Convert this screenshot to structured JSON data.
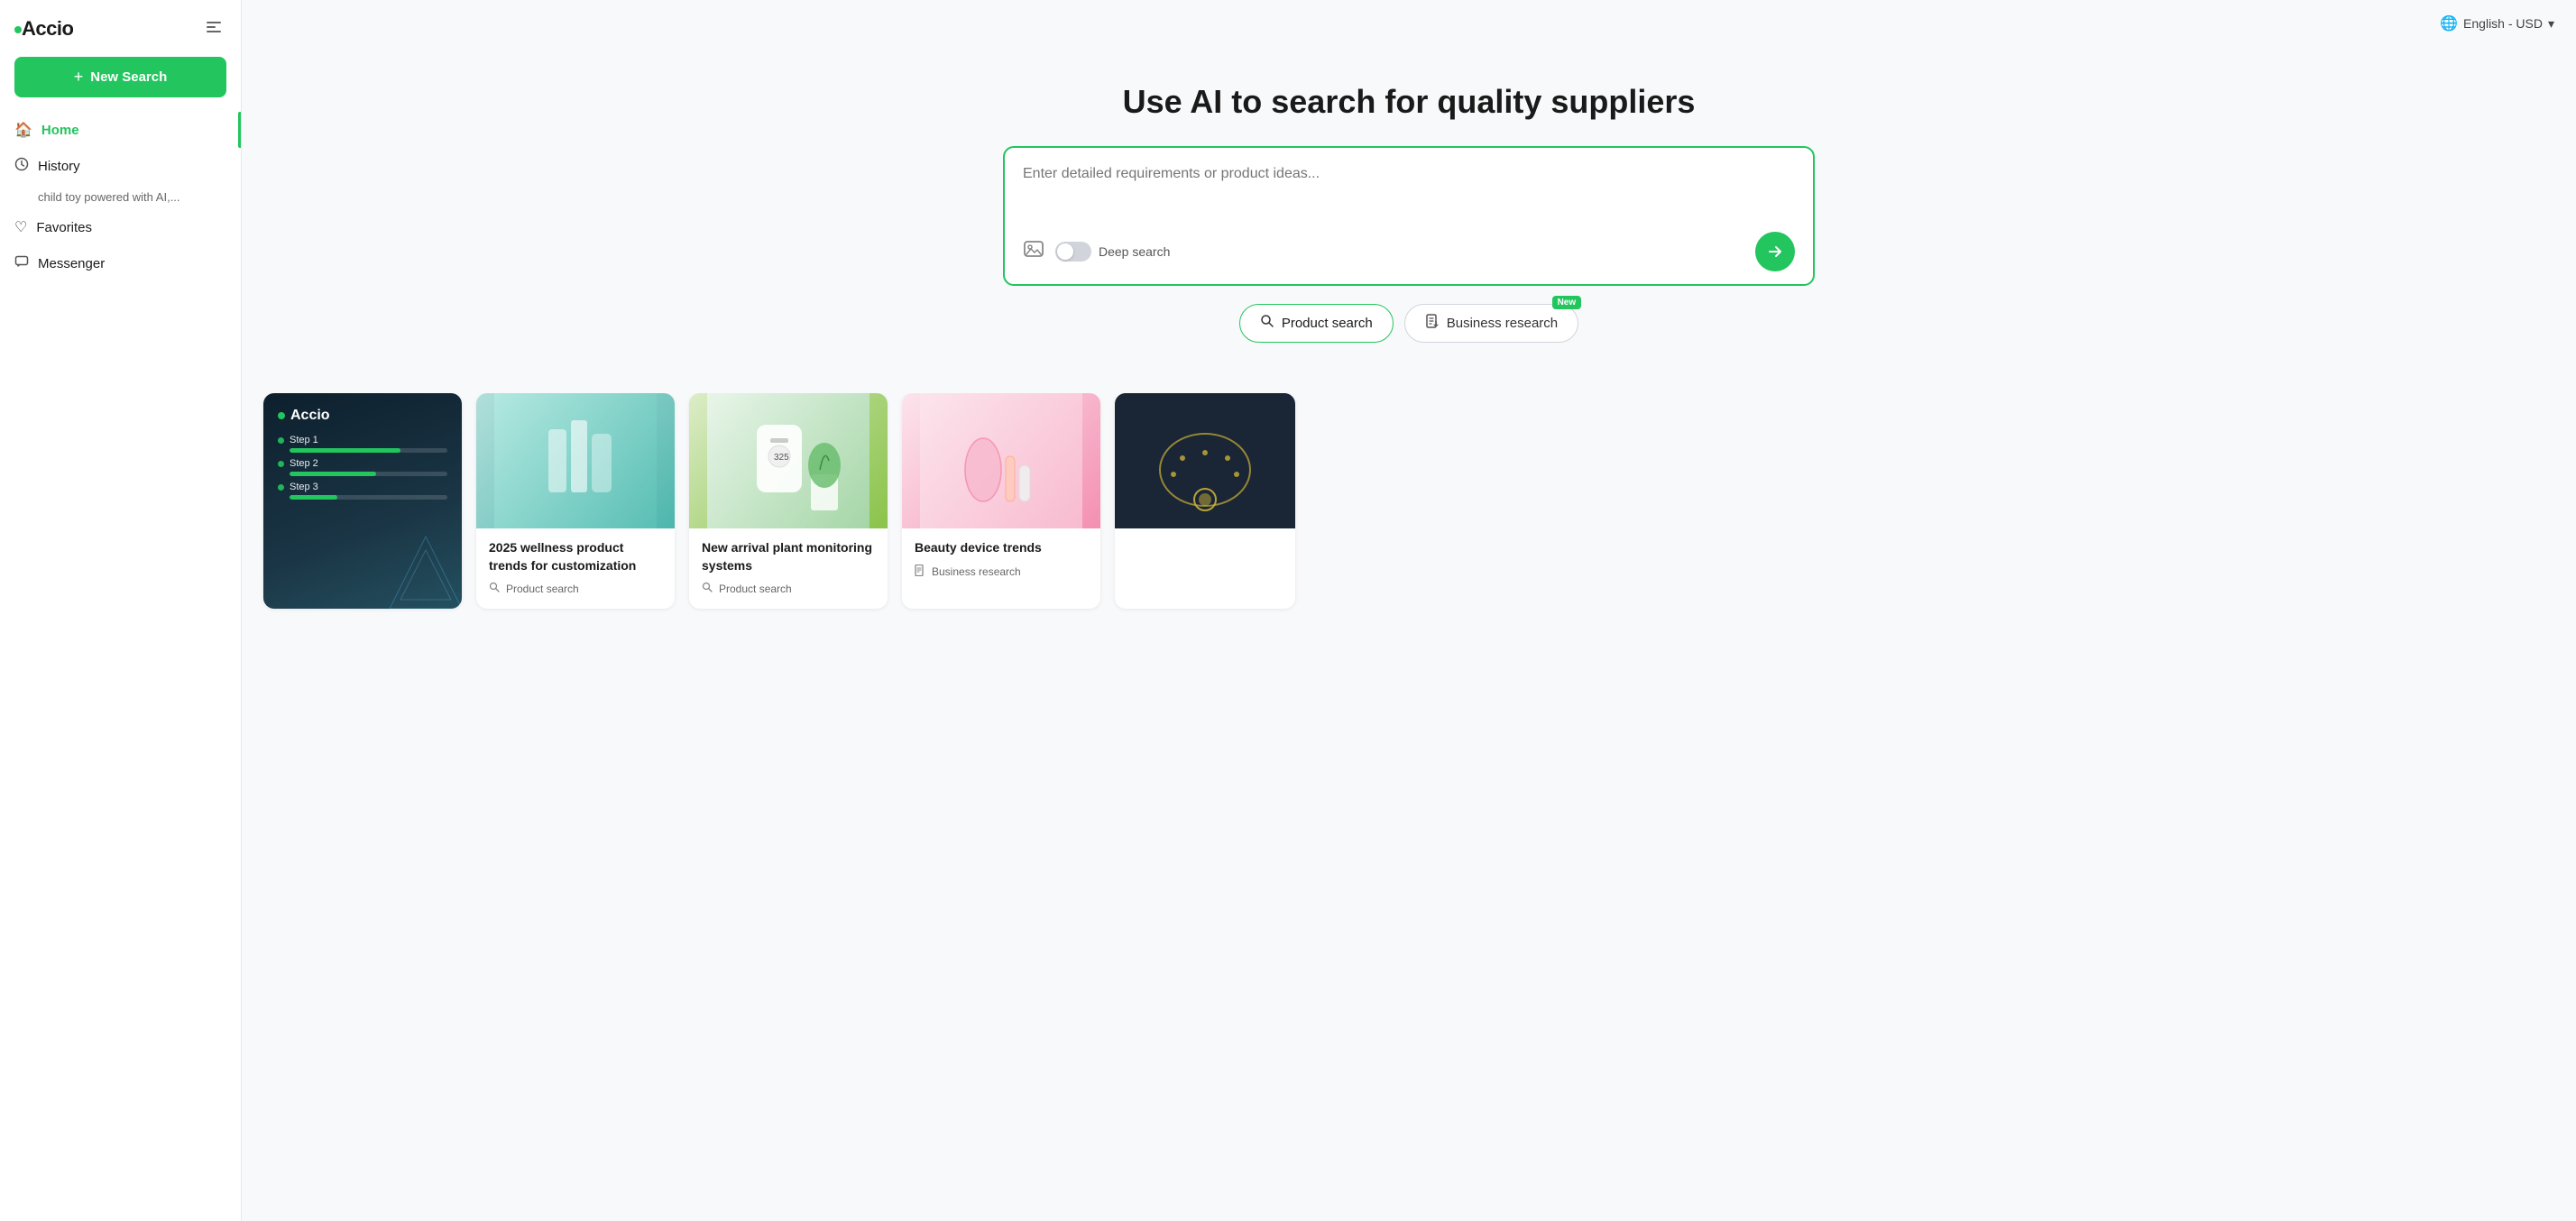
{
  "logo": {
    "text": "Accio",
    "dot": true
  },
  "sidebar": {
    "toggle_label": "Toggle sidebar",
    "new_search_label": "New Search",
    "nav_items": [
      {
        "id": "home",
        "label": "Home",
        "icon": "🏠",
        "active": true
      },
      {
        "id": "history",
        "label": "History",
        "icon": "🕐",
        "active": false
      },
      {
        "id": "favorites",
        "label": "Favorites",
        "icon": "♡",
        "active": false
      },
      {
        "id": "messenger",
        "label": "Messenger",
        "icon": "💬",
        "active": false
      }
    ],
    "history_item": "child toy powered with AI,..."
  },
  "topbar": {
    "language_label": "English - USD",
    "chevron": "▾"
  },
  "hero": {
    "title": "Use AI to search for quality suppliers",
    "search_placeholder": "Enter detailed requirements or product ideas...",
    "deep_search_label": "Deep search",
    "send_label": "Send"
  },
  "search_types": [
    {
      "id": "product-search",
      "label": "Product search",
      "icon": "🔍",
      "active": true,
      "badge": null
    },
    {
      "id": "business-research",
      "label": "Business research",
      "icon": "📋",
      "active": false,
      "badge": "New"
    }
  ],
  "cards": [
    {
      "id": "accio-card",
      "type": "accio",
      "brand": "Accio",
      "steps": [
        {
          "label": "Step 1",
          "width": 70
        },
        {
          "label": "Step 2",
          "width": 55
        },
        {
          "label": "Step 3",
          "width": 40
        }
      ]
    },
    {
      "id": "wellness-card",
      "type": "image",
      "image_color": "#a8d8c8",
      "title": "2025 wellness product trends for customization",
      "tag_icon": "🔍",
      "tag": "Product search"
    },
    {
      "id": "plant-card",
      "type": "image",
      "image_color": "#c8d8b0",
      "title": "New arrival plant monitoring systems",
      "tag_icon": "🔍",
      "tag": "Product search"
    },
    {
      "id": "beauty-card",
      "type": "image",
      "image_color": "#e8d0c8",
      "title": "Beauty device trends",
      "tag_icon": "📋",
      "tag": "Business research"
    },
    {
      "id": "jewelry-card",
      "type": "image",
      "image_color": "#1a2535",
      "title": "",
      "tag_icon": "",
      "tag": ""
    }
  ]
}
